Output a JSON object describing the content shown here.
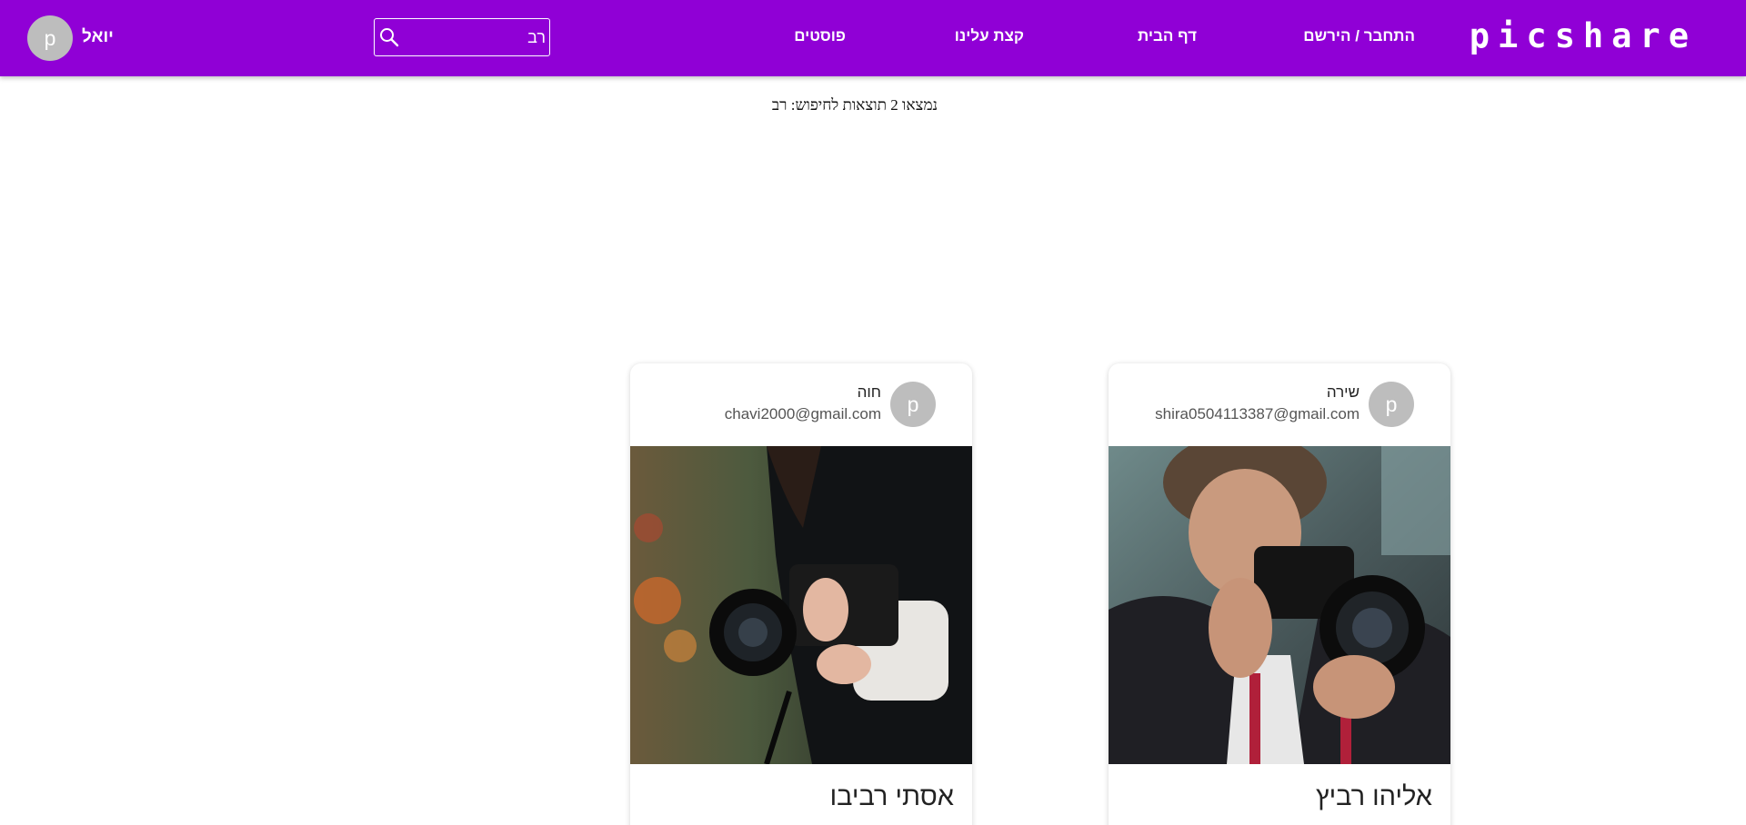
{
  "header": {
    "logo": "picshare",
    "nav": {
      "login_register": "התחבר / הירשם",
      "home": "דף הבית",
      "about": "קצת עלינו",
      "posts": "פוסטים"
    },
    "search": {
      "value": "רב",
      "icon": "search-icon"
    },
    "user": {
      "name": "יואל",
      "avatar_letter": "p"
    }
  },
  "results": {
    "text": "נמצאו 2 תוצאות לחיפוש: רב"
  },
  "cards": [
    {
      "user_name": "שירה",
      "email": "shira0504113387@gmail.com",
      "avatar_letter": "p",
      "title": "אליהו רביץ"
    },
    {
      "user_name": "חוה",
      "email": "chavi2000@gmail.com",
      "avatar_letter": "p",
      "title": "אסתי רביבו"
    }
  ],
  "colors": {
    "brand": "#9000d6",
    "avatar_bg": "#bdbdbd"
  }
}
